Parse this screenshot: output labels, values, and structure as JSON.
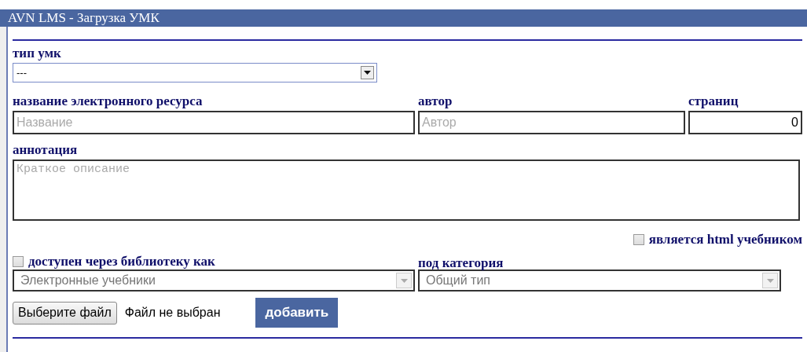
{
  "window": {
    "title": "AVN LMS - Загрузка УМК"
  },
  "type_field": {
    "label": "тип умк",
    "value": "---"
  },
  "name_field": {
    "label": "название электронного ресурса",
    "placeholder": "Название"
  },
  "author_field": {
    "label": "автор",
    "placeholder": "Автор"
  },
  "pages_field": {
    "label": "страниц",
    "value": "0"
  },
  "annotation_field": {
    "label": "аннотация",
    "placeholder": "Краткое описание"
  },
  "html_checkbox": {
    "label": "является html учебником",
    "checked": false
  },
  "library_checkbox": {
    "label": "доступен через библиотеку как",
    "checked": false
  },
  "library_select": {
    "value": "Электронные учебники",
    "disabled": true
  },
  "subcategory": {
    "label": "под категория",
    "value": "Общий тип",
    "disabled": true
  },
  "file_button": {
    "label": "Выберите файл"
  },
  "file_status": "Файл не выбран",
  "add_button": {
    "label": "добавить"
  }
}
